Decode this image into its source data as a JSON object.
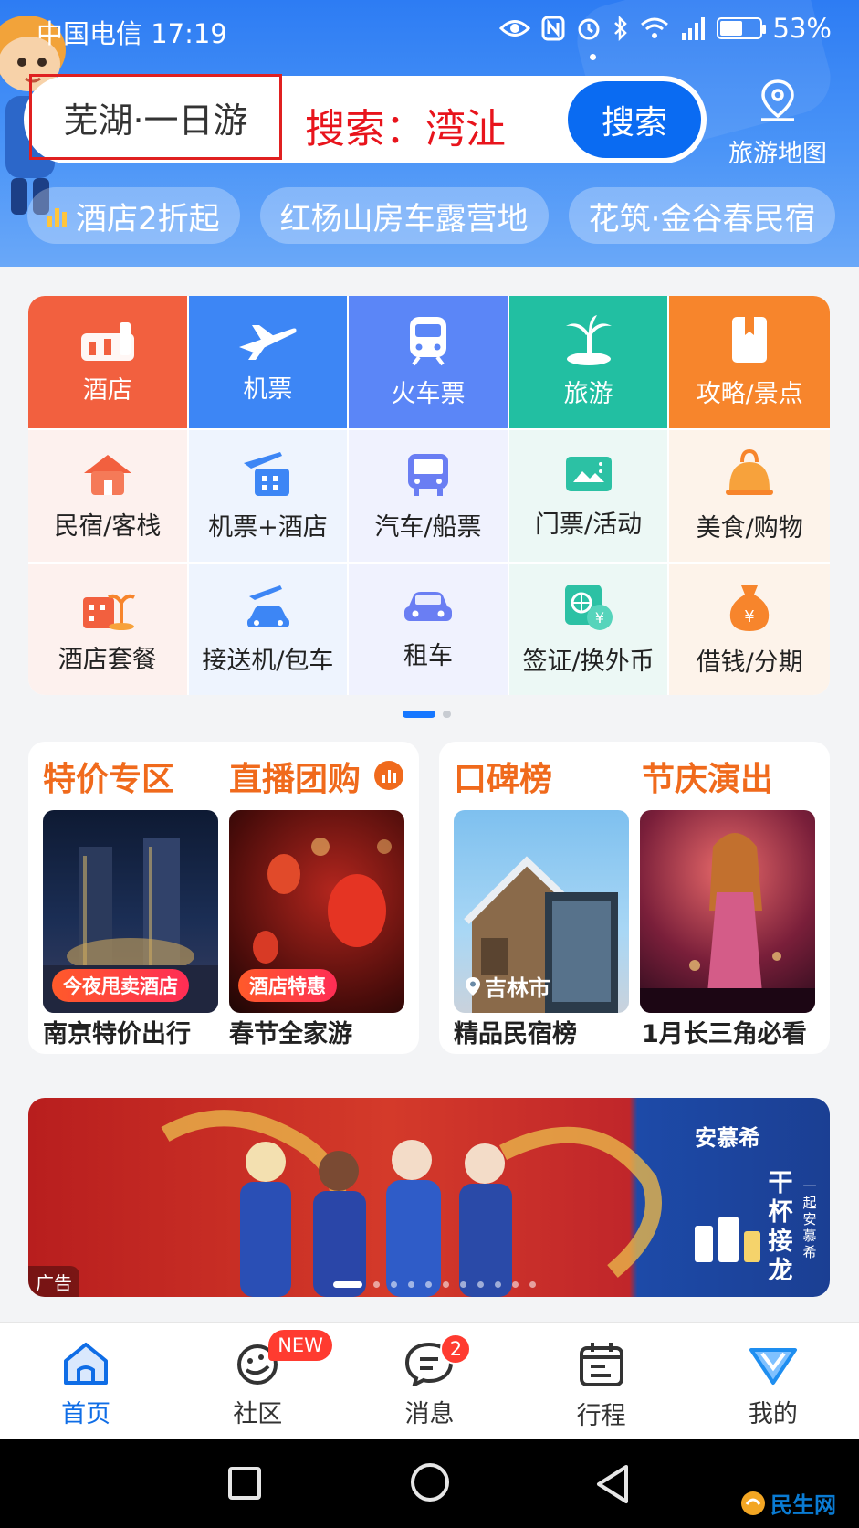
{
  "status_bar": {
    "carrier_time": "中国电信 17:19",
    "battery": "53%"
  },
  "search": {
    "keyword": "芜湖·一日游",
    "placeholder": "搜索：湾沚",
    "button": "搜索"
  },
  "map": {
    "label": "旅游地图"
  },
  "chips": [
    "酒店2折起",
    "红杨山房车露营地",
    "花筑·金谷春民宿"
  ],
  "grid": {
    "row1": [
      {
        "label": "酒店",
        "icon": "hotel-icon",
        "color": "#f2603f"
      },
      {
        "label": "机票",
        "icon": "plane-icon",
        "color": "#3d86f5"
      },
      {
        "label": "火车票",
        "icon": "train-icon",
        "color": "#5b86f7"
      },
      {
        "label": "旅游",
        "icon": "palm-tree-icon",
        "color": "#22bfa2"
      },
      {
        "label": "攻略/景点",
        "icon": "guide-book-icon",
        "color": "#f7852c"
      }
    ],
    "row2": [
      {
        "label": "民宿/客栈",
        "icon": "homestay-icon"
      },
      {
        "label": "机票+酒店",
        "icon": "flight-hotel-icon"
      },
      {
        "label": "汽车/船票",
        "icon": "bus-icon"
      },
      {
        "label": "门票/活动",
        "icon": "ticket-icon"
      },
      {
        "label": "美食/购物",
        "icon": "food-shopping-icon"
      }
    ],
    "row3": [
      {
        "label": "酒店套餐",
        "icon": "hotel-package-icon"
      },
      {
        "label": "接送机/包车",
        "icon": "airport-transfer-icon"
      },
      {
        "label": "租车",
        "icon": "car-rental-icon"
      },
      {
        "label": "签证/换外币",
        "icon": "visa-currency-icon"
      },
      {
        "label": "借钱/分期",
        "icon": "money-bag-icon"
      }
    ]
  },
  "promos": {
    "left": {
      "title1": "特价专区",
      "title2": "直播团购",
      "items": [
        {
          "tag": "今夜甩卖酒店",
          "caption": "南京特价出行"
        },
        {
          "tag": "酒店特惠",
          "caption": "春节全家游"
        }
      ]
    },
    "right": {
      "title1": "口碑榜",
      "title2": "节庆演出",
      "items": [
        {
          "location": "吉林市",
          "caption": "精品民宿榜"
        },
        {
          "caption": "1月长三角必看"
        }
      ]
    }
  },
  "ad": {
    "label": "广告",
    "brand": "安慕希",
    "slogan": "干杯接龙",
    "slogan_small": "一起安慕希"
  },
  "tabbar": [
    {
      "label": "首页",
      "active": true
    },
    {
      "label": "社区",
      "badge": "NEW"
    },
    {
      "label": "消息",
      "badge": "2"
    },
    {
      "label": "行程"
    },
    {
      "label": "我的"
    }
  ],
  "watermark": "民生网"
}
